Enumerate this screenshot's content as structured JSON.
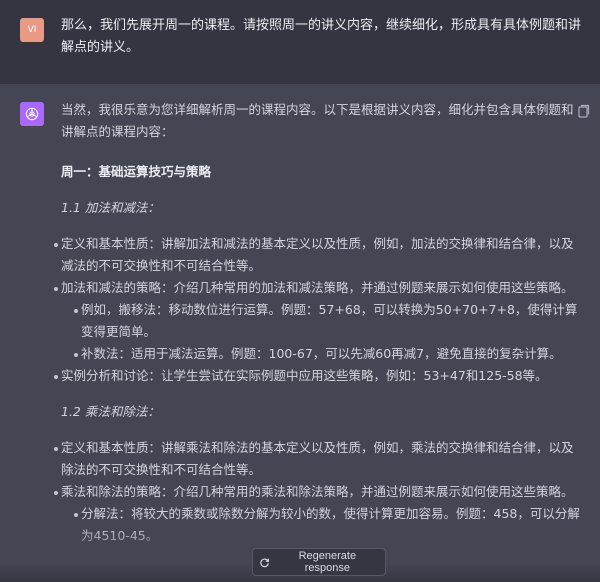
{
  "user_message": {
    "avatar_initials": "VI",
    "text": "那么，我们先展开周一的课程。请按照周一的讲义内容，继续细化，形成具有具体例题和讲解点的讲义。"
  },
  "assistant_message": {
    "intro": "当然，我很乐意为您详细解析周一的课程内容。以下是根据讲义内容，细化并包含具体例题和讲解点的课程内容：",
    "heading": "周一：基础运算技巧与策略",
    "sections": [
      {
        "title": "1.1 加法和减法：",
        "items": [
          {
            "text": "定义和基本性质：讲解加法和减法的基本定义以及性质，例如，加法的交换律和结合律，以及减法的不可交换性和不可结合性等。"
          },
          {
            "text": "加法和减法的策略：介绍几种常用的加法和减法策略，并通过例题来展示如何使用这些策略。",
            "subitems": [
              "例如，搬移法：移动数位进行运算。例题：57+68，可以转换为50+70+7+8，使得计算变得更简单。",
              "补数法：适用于减法运算。例题：100-67，可以先减60再减7，避免直接的复杂计算。"
            ]
          },
          {
            "text": "实例分析和讨论：让学生尝试在实际例题中应用这些策略，例如：53+47和125-58等。"
          }
        ]
      },
      {
        "title": "1.2 乘法和除法：",
        "items": [
          {
            "text": "定义和基本性质：讲解乘法和除法的基本定义以及性质，例如，乘法的交换律和结合律，以及除法的不可交换性和不可结合性等。"
          },
          {
            "text": "乘法和除法的策略：介绍几种常用的乘法和除法策略，并通过例题来展示如何使用这些策略。",
            "subitems": [
              "分解法：将较大的乘数或除数分解为较小的数，使得计算更加容易。例题：458，可以分解为4510-45。"
            ]
          }
        ]
      }
    ]
  },
  "regenerate_label": "Regenerate response",
  "colors": {
    "user_bg": "#343541",
    "assistant_bg": "#444654",
    "user_avatar": "#e99a84",
    "assistant_avatar": "#ab68ff"
  }
}
